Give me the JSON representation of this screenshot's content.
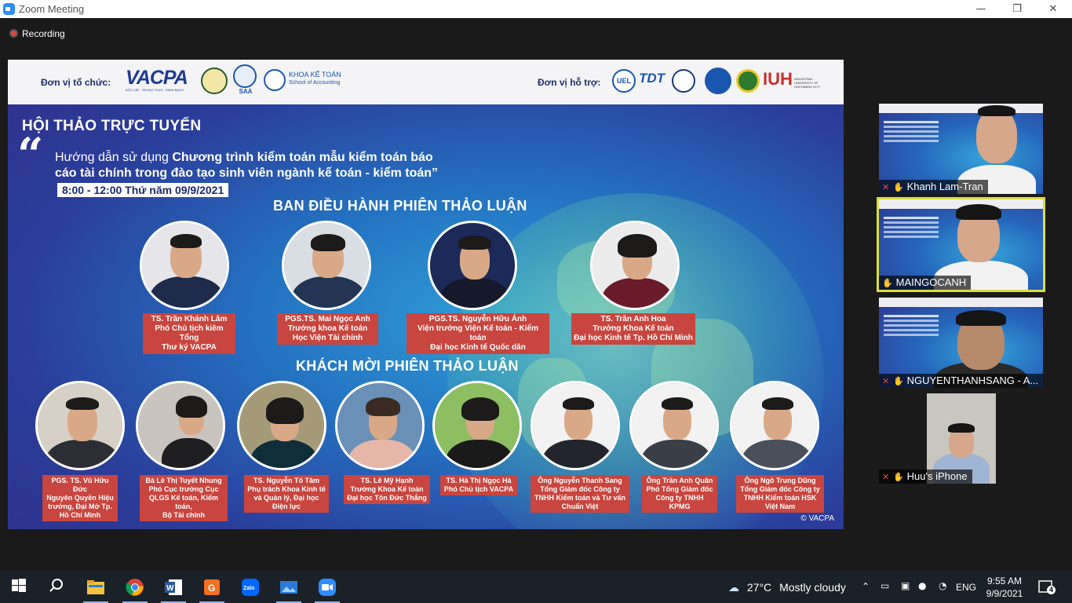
{
  "window": {
    "title": "Zoom Meeting",
    "minimize": "—",
    "maximize": "❐",
    "close": "✕"
  },
  "meeting": {
    "recording_label": "Recording"
  },
  "slide": {
    "organizer_label": "Đơn vị tổ chức:",
    "sponsor_label": "Đơn vị hỗ trợ:",
    "vacpa_logo": "VACPA",
    "vacpa_tagline": "ĐỘC LẬP - TRUNG THỰC - MINH BẠCH",
    "saa_logo": "SAA",
    "school_logo": "KHOA KẾ TOÁN",
    "school_logo_sub": "School of Accounting",
    "uel_logo": "UEL",
    "tdt_logo": "TDT",
    "iuh_logo": "IUH",
    "iuh_sub": "INDUSTRIAL UNIVERSITY OF HOCHIMINH CITY",
    "heading": "HỘI THẢO TRỰC TUYẾN",
    "subtitle_prefix": "Hướng dẫn sử dụng ",
    "subtitle_bold": "Chương trình kiểm toán mẫu kiểm toán báo",
    "subtitle_line2": "cáo tài chính trong đào tạo sinh viên ngành kế toán - kiểm toán”",
    "date": "8:00 - 12:00 Thứ năm 09/9/2021",
    "moderators_title": "BAN ĐIỀU HÀNH PHIÊN THẢO LUẬN",
    "guests_title": "KHÁCH MỜI PHIÊN THẢO LUẬN",
    "moderators": [
      {
        "caption": "TS. Trần Khánh Lâm\nPhó Chủ tịch kiêm Tổng\nThư ký VACPA"
      },
      {
        "caption": "PGS.TS. Mai Ngọc Anh\nTrưởng khoa Kế toán\nHọc Viện Tài chính"
      },
      {
        "caption": "PGS.TS. Nguyễn Hữu Ánh\nViện trưởng Viện Kế toán - Kiểm toán\nĐại học Kinh tế Quốc dân"
      },
      {
        "caption": "TS. Trần Anh Hoa\nTrưởng Khoa Kế toán\nĐại học Kinh tế Tp. Hồ Chí Minh"
      }
    ],
    "guests": [
      {
        "caption": "PGS. TS. Vũ Hữu Đức\nNguyên Quyền Hiệu\ntrưởng, Đại Mở Tp.\nHồ Chí Minh"
      },
      {
        "caption": "Bà Lê Thị Tuyết Nhung\nPhó Cục trưởng Cục\nQLGS Kế toán, Kiểm toán,\nBộ Tài chính"
      },
      {
        "caption": "TS. Nguyễn Tố Tâm\nPhụ trách Khoa Kinh tế\nvà Quản lý, Đại học\nĐiện lực"
      },
      {
        "caption": "TS. Lê Mỹ Hạnh\nTrưởng Khoa Kế toán\nĐại học Tôn Đức Thắng"
      },
      {
        "caption": "TS. Hà Thị Ngọc Hà\nPhó Chủ tịch VACPA"
      },
      {
        "caption": "Ông Nguyễn Thanh Sang\nTổng Giám đốc Công ty\nTNHH Kiểm toán và Tư vấn\nChuẩn Việt"
      },
      {
        "caption": "Ông Trần Anh Quân\nPhó Tổng Giám đốc\nCông ty TNHH KPMG"
      },
      {
        "caption": "Ông Ngô Trung Dũng\nTổng Giám đốc Công ty\nTNHH Kiểm toán HSK\nViệt Nam"
      }
    ],
    "copyright": "© VACPA"
  },
  "participants": [
    {
      "name": "Khanh Lam-Tran"
    },
    {
      "name": "MAINGOCANH"
    },
    {
      "name": "NGUYENTHANHSANG - A..."
    },
    {
      "name": "Huu's iPhone"
    }
  ],
  "taskbar": {
    "weather_temp": "27°C",
    "weather_text": "Mostly cloudy",
    "language": "ENG",
    "time": "9:55 AM",
    "date": "9/9/2021",
    "notification_count": "4"
  },
  "colors": {
    "caption_red": "#c9453f",
    "active_border": "#d9dd40",
    "zoom_blue": "#2d8cff"
  }
}
